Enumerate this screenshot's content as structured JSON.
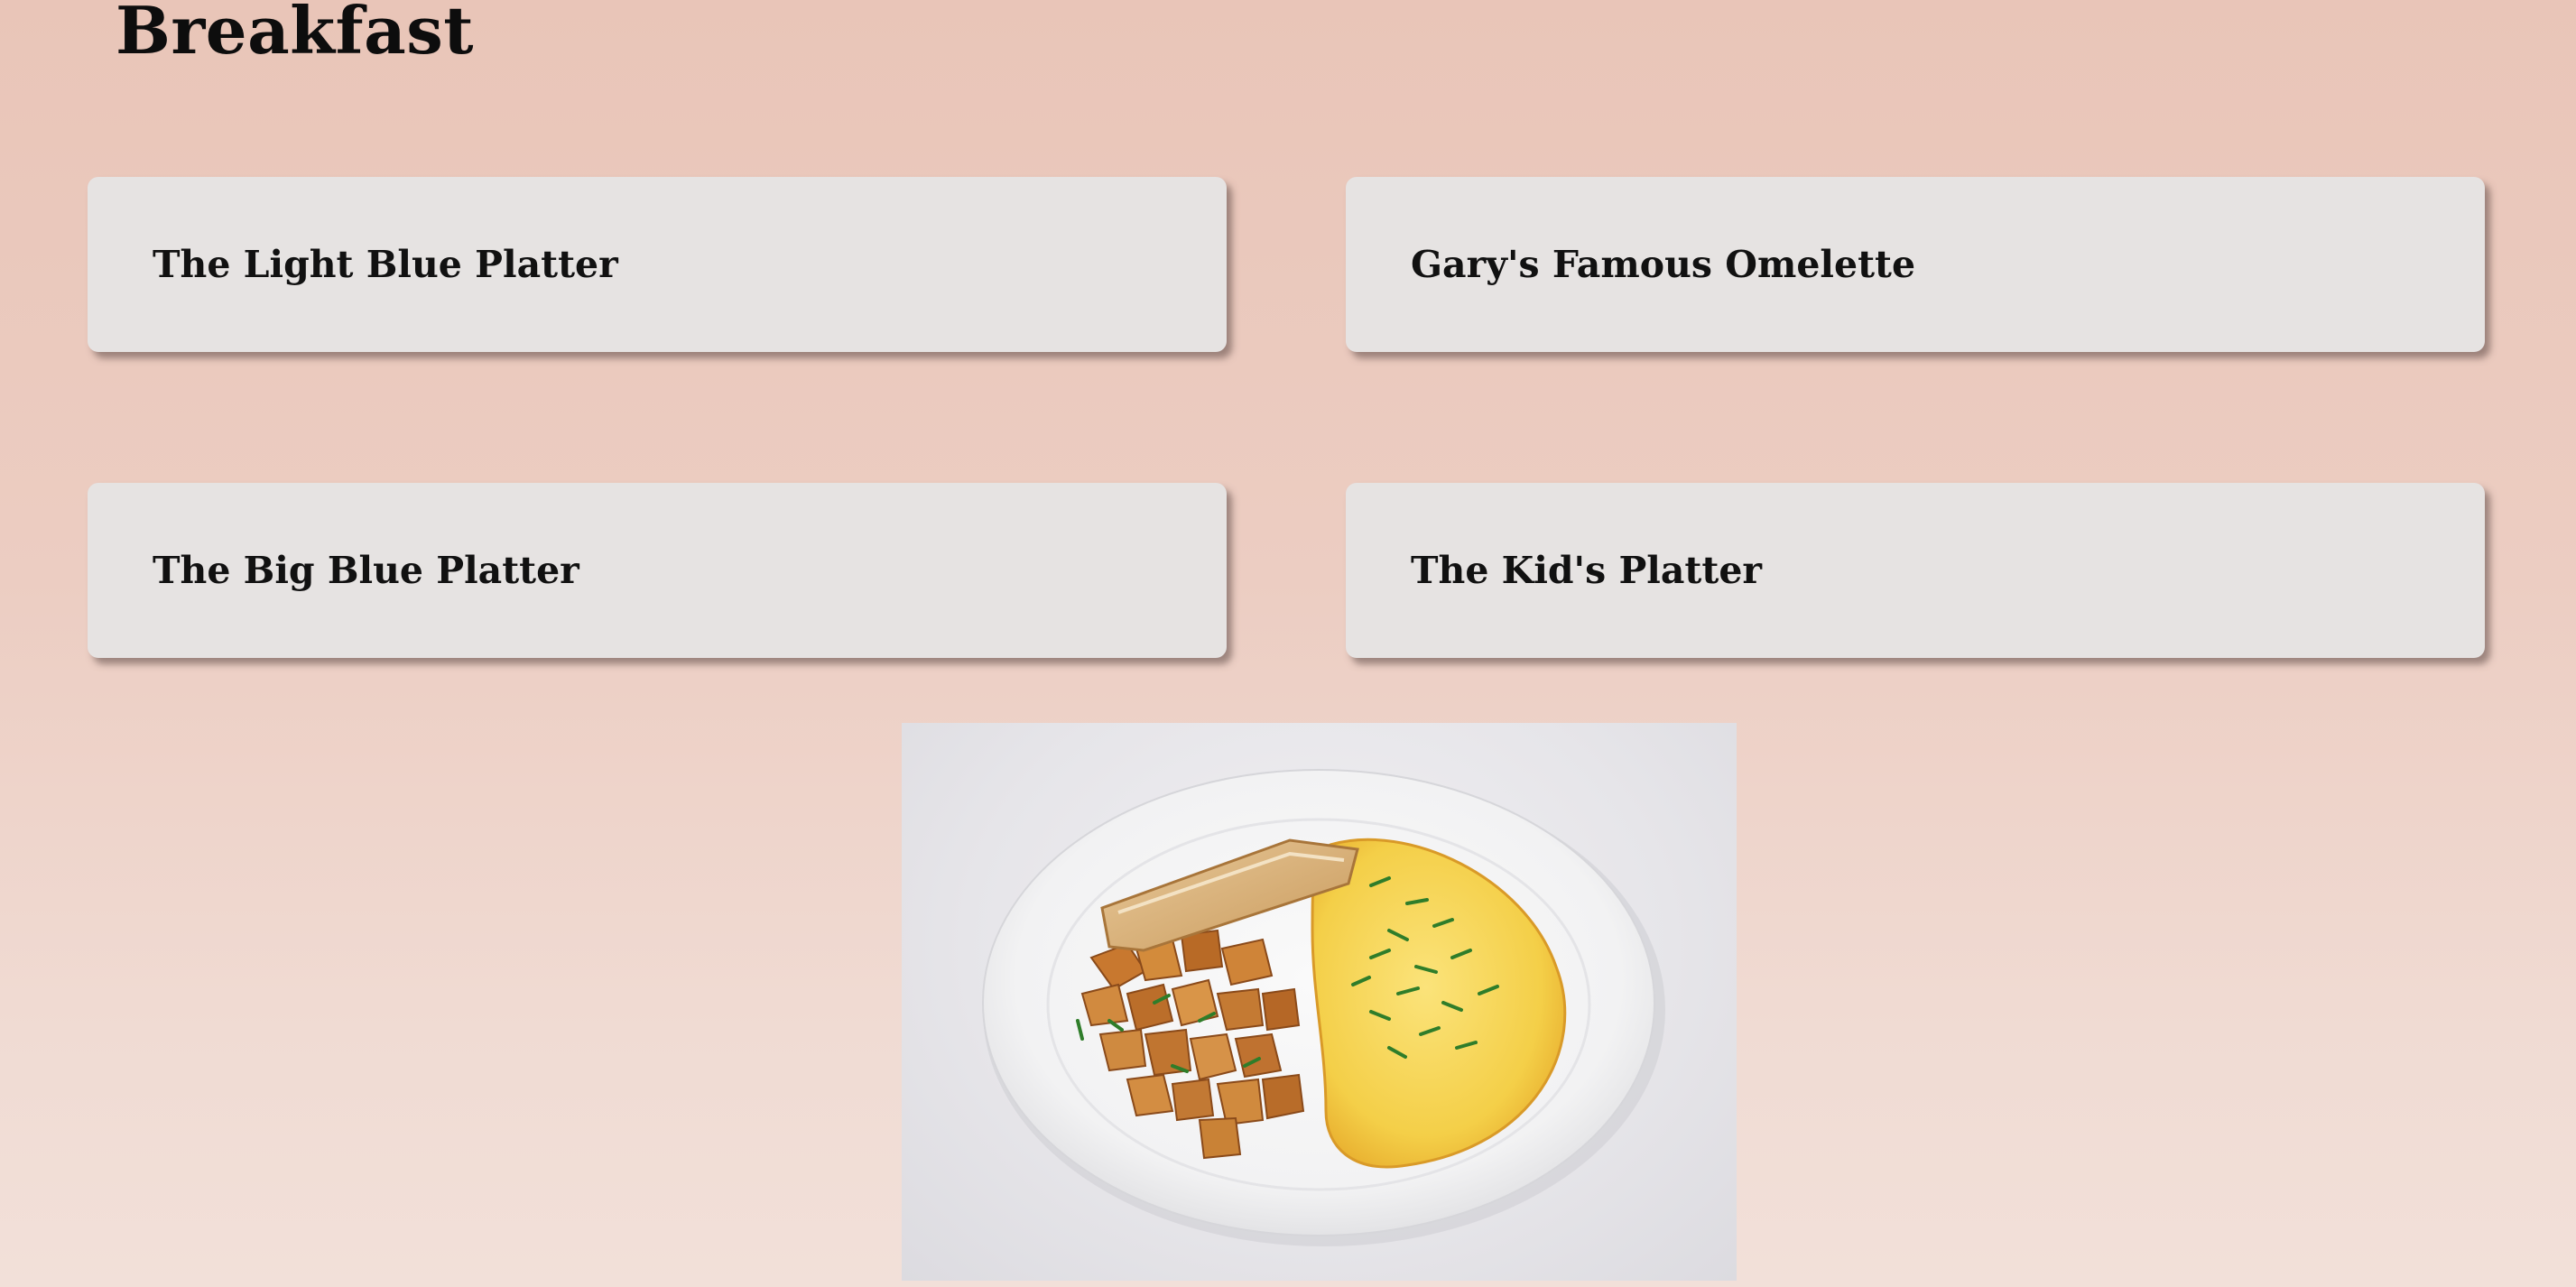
{
  "section": {
    "title": "Breakfast"
  },
  "menu_items": [
    {
      "label": "The Light Blue Platter"
    },
    {
      "label": "Gary's Famous Omelette"
    },
    {
      "label": "The Big Blue Platter"
    },
    {
      "label": "The Kid's Platter"
    }
  ],
  "photo": {
    "icon": "omelette-plate-photo"
  }
}
